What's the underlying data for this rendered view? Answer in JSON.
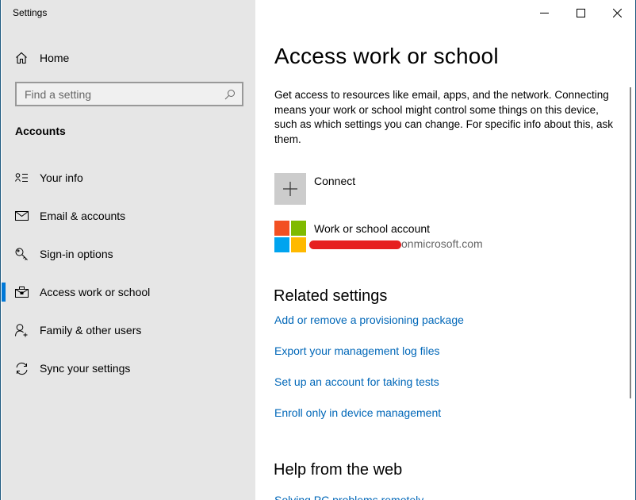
{
  "window": {
    "app_title": "Settings",
    "controls": {
      "minimize": "minimize",
      "maximize": "maximize",
      "close": "close"
    }
  },
  "sidebar": {
    "home_label": "Home",
    "search": {
      "placeholder": "Find a setting",
      "value": ""
    },
    "section_title": "Accounts",
    "items": [
      {
        "label": "Your info",
        "icon": "contact-info-icon",
        "active": false
      },
      {
        "label": "Email & accounts",
        "icon": "mail-icon",
        "active": false
      },
      {
        "label": "Sign-in options",
        "icon": "key-icon",
        "active": false
      },
      {
        "label": "Access work or school",
        "icon": "briefcase-icon",
        "active": true
      },
      {
        "label": "Family & other users",
        "icon": "add-user-icon",
        "active": false
      },
      {
        "label": "Sync your settings",
        "icon": "sync-icon",
        "active": false
      }
    ]
  },
  "main": {
    "title": "Access work or school",
    "description": "Get access to resources like email, apps, and the network. Connecting means your work or school might control some things on this device, such as which settings you can change. For specific info about this, ask them.",
    "connect_label": "Connect",
    "account": {
      "name": "Work or school account",
      "email_visible_suffix": "onmicrosoft.com",
      "email_redacted": true
    },
    "related_settings": {
      "title": "Related settings",
      "links": [
        "Add or remove a provisioning package",
        "Export your management log files",
        "Set up an account for taking tests",
        "Enroll only in device management"
      ]
    },
    "help": {
      "title": "Help from the web",
      "links": [
        "Solving PC problems remotely"
      ]
    }
  },
  "colors": {
    "accent": "#0078d7",
    "link": "#0067b8",
    "sidebar_bg": "#e6e6e6",
    "ms_red": "#f25022",
    "ms_green": "#7fba00",
    "ms_blue": "#00a4ef",
    "ms_yellow": "#ffb900",
    "redaction": "#e62020"
  }
}
